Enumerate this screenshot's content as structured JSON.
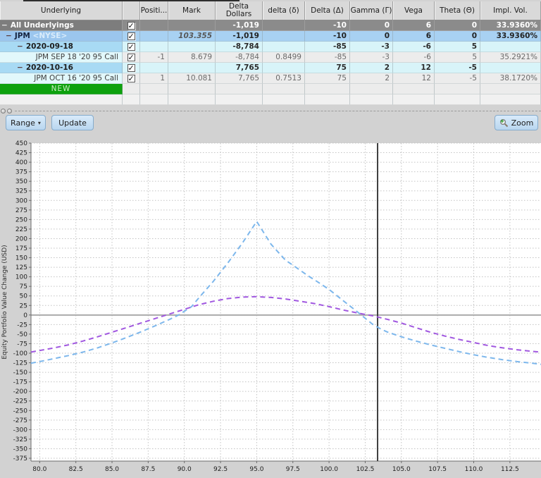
{
  "toolbar": {
    "range_label": "Range",
    "update_label": "Update",
    "zoom_label": "Zoom"
  },
  "icons": {
    "checkbox_check": "✓",
    "range_caret": "▾",
    "zoom_button_icon": "magnifier-plus-icon"
  },
  "table": {
    "columns": [
      {
        "key": "label",
        "label": "Underlying"
      },
      {
        "key": "checked",
        "label": ""
      },
      {
        "key": "position",
        "label": "Positi..."
      },
      {
        "key": "mark",
        "label": "Mark"
      },
      {
        "key": "delta_dollars",
        "label": "Delta Dollars"
      },
      {
        "key": "delta",
        "label": "delta (δ)"
      },
      {
        "key": "Delta",
        "label": "Delta (Δ)"
      },
      {
        "key": "gamma",
        "label": "Gamma (Γ)"
      },
      {
        "key": "vega",
        "label": "Vega"
      },
      {
        "key": "theta",
        "label": "Theta (Θ)"
      },
      {
        "key": "impl_vol",
        "label": "Impl. Vol."
      }
    ],
    "rows": [
      {
        "type": "all",
        "prefix": "−",
        "label": "All Underlyings",
        "checked": true,
        "position": "",
        "mark": "",
        "delta_dollars": "-1,019",
        "delta": "",
        "Delta": "-10",
        "gamma": "0",
        "vega": "6",
        "theta": "0",
        "impl_vol": "33.9360%"
      },
      {
        "type": "underlying",
        "prefix": "−",
        "label": "JPM",
        "exchange": "<NYSE>",
        "checked": true,
        "position": "",
        "mark": "103.355",
        "delta_dollars": "-1,019",
        "delta": "",
        "Delta": "-10",
        "gamma": "0",
        "vega": "6",
        "theta": "0",
        "impl_vol": "33.9360%"
      },
      {
        "type": "expiry",
        "prefix": "−",
        "label": "2020-09-18",
        "checked": true,
        "position": "",
        "mark": "",
        "delta_dollars": "-8,784",
        "delta": "",
        "Delta": "-85",
        "gamma": "-3",
        "vega": "-6",
        "theta": "5",
        "impl_vol": ""
      },
      {
        "type": "option",
        "label": "JPM SEP 18 '20 95 Call",
        "checked": true,
        "position": "-1",
        "mark": "8.679",
        "delta_dollars": "-8,784",
        "delta": "0.8499",
        "Delta": "-85",
        "gamma": "-3",
        "vega": "-6",
        "theta": "5",
        "impl_vol": "35.2921%"
      },
      {
        "type": "expiry",
        "prefix": "−",
        "label": "2020-10-16",
        "checked": true,
        "position": "",
        "mark": "",
        "delta_dollars": "7,765",
        "delta": "",
        "Delta": "75",
        "gamma": "2",
        "vega": "12",
        "theta": "-5",
        "impl_vol": ""
      },
      {
        "type": "option",
        "label": "JPM OCT 16 '20 95 Call",
        "checked": true,
        "position": "1",
        "mark": "10.081",
        "delta_dollars": "7,765",
        "delta": "0.7513",
        "Delta": "75",
        "gamma": "2",
        "vega": "12",
        "theta": "-5",
        "impl_vol": "38.1720%"
      },
      {
        "type": "new",
        "label": "NEW"
      },
      {
        "type": "empty",
        "label": ""
      }
    ]
  },
  "chart_data": {
    "type": "line",
    "title": "",
    "xlabel": "",
    "ylabel": "Equity Portfolio Value Change (USD)",
    "xlim": [
      79.4,
      114.65
    ],
    "ylim": [
      -380,
      450
    ],
    "x_ticks": [
      80.0,
      82.5,
      85.0,
      87.5,
      90.0,
      92.5,
      95.0,
      97.5,
      100.0,
      102.5,
      105.0,
      107.5,
      110.0,
      112.5
    ],
    "y_tick_step": 25,
    "y_tick_max": 450,
    "y_tick_min": -375,
    "grid": "dotted",
    "legend": "none",
    "vertical_marker_x": 103.355,
    "colors": {
      "grid": "#c3c3c3",
      "zero_line": "#ababab",
      "marker": "#3f3f3f",
      "axis": "#6b6b6b",
      "tick_text": "#1e1e1e",
      "plot_bg": "#ffffff"
    },
    "series": [
      {
        "name": "series-blue-dashed",
        "color": "#7db7ec",
        "style": "dashed",
        "points": [
          [
            79.4,
            -126
          ],
          [
            80,
            -122
          ],
          [
            81,
            -114
          ],
          [
            82,
            -106
          ],
          [
            83,
            -97
          ],
          [
            84,
            -86
          ],
          [
            85,
            -73
          ],
          [
            86,
            -59
          ],
          [
            87,
            -44
          ],
          [
            88,
            -28
          ],
          [
            89,
            -11
          ],
          [
            89.6,
            0
          ],
          [
            90.5,
            22
          ],
          [
            91,
            45
          ],
          [
            92,
            88
          ],
          [
            93,
            136
          ],
          [
            94,
            188
          ],
          [
            95,
            245
          ],
          [
            96,
            185
          ],
          [
            97,
            143
          ],
          [
            97.6,
            128
          ],
          [
            98.5,
            104
          ],
          [
            99.2,
            87
          ],
          [
            100,
            67
          ],
          [
            101,
            37
          ],
          [
            102,
            7
          ],
          [
            103,
            -24
          ],
          [
            103.5,
            -35
          ],
          [
            104,
            -44
          ],
          [
            105,
            -57
          ],
          [
            106,
            -68
          ],
          [
            107,
            -78
          ],
          [
            108,
            -87
          ],
          [
            109,
            -96
          ],
          [
            110,
            -104
          ],
          [
            111,
            -111
          ],
          [
            112,
            -117
          ],
          [
            113,
            -122
          ],
          [
            114,
            -126
          ],
          [
            114.65,
            -129
          ]
        ]
      },
      {
        "name": "series-purple-dashed",
        "color": "#a158e0",
        "style": "dashed",
        "points": [
          [
            79.4,
            -97
          ],
          [
            80,
            -93
          ],
          [
            81,
            -86
          ],
          [
            82,
            -78
          ],
          [
            83,
            -68
          ],
          [
            84,
            -57
          ],
          [
            85,
            -45
          ],
          [
            86,
            -33
          ],
          [
            87,
            -21
          ],
          [
            88,
            -9
          ],
          [
            89,
            3
          ],
          [
            90,
            15
          ],
          [
            91,
            27
          ],
          [
            92,
            36
          ],
          [
            93,
            43
          ],
          [
            94,
            47
          ],
          [
            95,
            48
          ],
          [
            96,
            46
          ],
          [
            97,
            42
          ],
          [
            98,
            36
          ],
          [
            99,
            30
          ],
          [
            100,
            22
          ],
          [
            101,
            13
          ],
          [
            102,
            5
          ],
          [
            103,
            -2
          ],
          [
            104,
            -11
          ],
          [
            105,
            -21
          ],
          [
            106,
            -33
          ],
          [
            107,
            -45
          ],
          [
            108,
            -55
          ],
          [
            109,
            -64
          ],
          [
            110,
            -72
          ],
          [
            111,
            -80
          ],
          [
            112,
            -86
          ],
          [
            113,
            -91
          ],
          [
            114,
            -95
          ],
          [
            114.65,
            -97
          ]
        ]
      }
    ]
  }
}
